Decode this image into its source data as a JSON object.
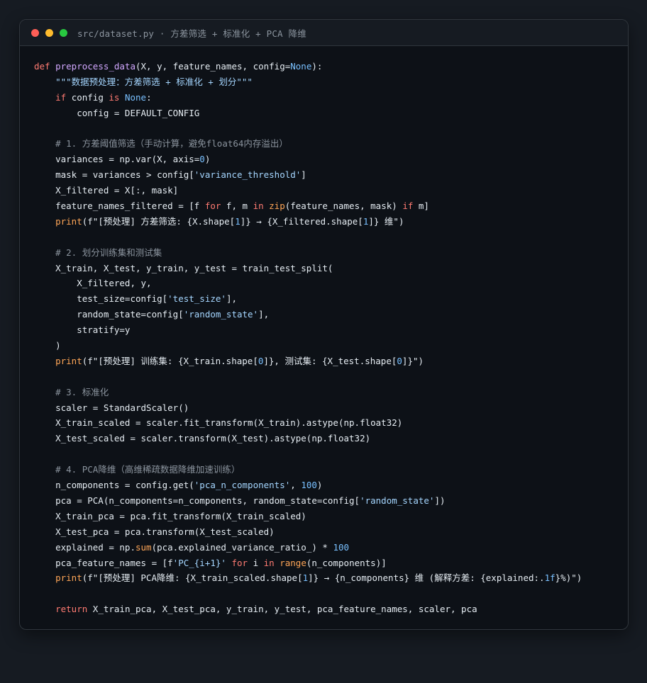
{
  "window": {
    "title": "src/dataset.py · 方差筛选 + 标准化 + PCA 降维"
  },
  "colors": {
    "background": "#161b22",
    "editor_bg": "#0d1117",
    "keyword": "#ff7b72",
    "function": "#d2a8ff",
    "builtin": "#ffa657",
    "constant": "#79c0ff",
    "string": "#a5d6ff",
    "comment": "#8b949e",
    "text": "#e6edf3"
  },
  "code_lines": [
    [
      [
        "kw",
        "def "
      ],
      [
        "fn",
        "preprocess_data"
      ],
      [
        "plain",
        "(X, y, feature_names, config="
      ],
      [
        "const",
        "None"
      ],
      [
        "plain",
        "):"
      ]
    ],
    [
      [
        "plain",
        "    "
      ],
      [
        "str",
        "\"\"\"数据预处理：方差筛选 + 标准化 + 划分\"\"\""
      ]
    ],
    [
      [
        "plain",
        "    "
      ],
      [
        "kw",
        "if"
      ],
      [
        "plain",
        " config "
      ],
      [
        "kw",
        "is"
      ],
      [
        "plain",
        " "
      ],
      [
        "const",
        "None"
      ],
      [
        "plain",
        ":"
      ]
    ],
    [
      [
        "plain",
        "        config = DEFAULT_CONFIG"
      ]
    ],
    [],
    [
      [
        "plain",
        "    "
      ],
      [
        "cmt",
        "# 1. 方差阈值筛选（手动计算，避免float64内存溢出）"
      ]
    ],
    [
      [
        "plain",
        "    variances = np.var(X, axis="
      ],
      [
        "const",
        "0"
      ],
      [
        "plain",
        ")"
      ]
    ],
    [
      [
        "plain",
        "    mask = variances > config["
      ],
      [
        "str",
        "'variance_threshold'"
      ],
      [
        "plain",
        "]"
      ]
    ],
    [
      [
        "plain",
        "    X_filtered = X[:, mask]"
      ]
    ],
    [
      [
        "plain",
        "    feature_names_filtered = [f "
      ],
      [
        "kw",
        "for"
      ],
      [
        "plain",
        " f, m "
      ],
      [
        "kw",
        "in"
      ],
      [
        "plain",
        " "
      ],
      [
        "builtin",
        "zip"
      ],
      [
        "plain",
        "(feature_names, mask) "
      ],
      [
        "kw",
        "if"
      ],
      [
        "plain",
        " m]"
      ]
    ],
    [
      [
        "plain",
        "    "
      ],
      [
        "builtin",
        "print"
      ],
      [
        "plain",
        "(f\"[预处理] 方差筛选: {X.shape["
      ],
      [
        "const",
        "1"
      ],
      [
        "plain",
        "]} → {X_filtered.shape["
      ],
      [
        "const",
        "1"
      ],
      [
        "plain",
        "]} 维\")"
      ]
    ],
    [],
    [
      [
        "plain",
        "    "
      ],
      [
        "cmt",
        "# 2. 划分训练集和测试集"
      ]
    ],
    [
      [
        "plain",
        "    X_train, X_test, y_train, y_test = train_test_split("
      ]
    ],
    [
      [
        "plain",
        "        X_filtered, y,"
      ]
    ],
    [
      [
        "plain",
        "        test_size=config["
      ],
      [
        "str",
        "'test_size'"
      ],
      [
        "plain",
        "],"
      ]
    ],
    [
      [
        "plain",
        "        random_state=config["
      ],
      [
        "str",
        "'random_state'"
      ],
      [
        "plain",
        "],"
      ]
    ],
    [
      [
        "plain",
        "        stratify=y"
      ]
    ],
    [
      [
        "plain",
        "    )"
      ]
    ],
    [
      [
        "plain",
        "    "
      ],
      [
        "builtin",
        "print"
      ],
      [
        "plain",
        "(f\"[预处理] 训练集: {X_train.shape["
      ],
      [
        "const",
        "0"
      ],
      [
        "plain",
        "]}, 测试集: {X_test.shape["
      ],
      [
        "const",
        "0"
      ],
      [
        "plain",
        "]}\")"
      ]
    ],
    [],
    [
      [
        "plain",
        "    "
      ],
      [
        "cmt",
        "# 3. 标准化"
      ]
    ],
    [
      [
        "plain",
        "    scaler = StandardScaler()"
      ]
    ],
    [
      [
        "plain",
        "    X_train_scaled = scaler.fit_transform(X_train).astype(np.float32)"
      ]
    ],
    [
      [
        "plain",
        "    X_test_scaled = scaler.transform(X_test).astype(np.float32)"
      ]
    ],
    [],
    [
      [
        "plain",
        "    "
      ],
      [
        "cmt",
        "# 4. PCA降维（高维稀疏数据降维加速训练）"
      ]
    ],
    [
      [
        "plain",
        "    n_components = config.get("
      ],
      [
        "str",
        "'pca_n_components'"
      ],
      [
        "plain",
        ", "
      ],
      [
        "const",
        "100"
      ],
      [
        "plain",
        ")"
      ]
    ],
    [
      [
        "plain",
        "    pca = PCA(n_components=n_components, random_state=config["
      ],
      [
        "str",
        "'random_state'"
      ],
      [
        "plain",
        "])"
      ]
    ],
    [
      [
        "plain",
        "    X_train_pca = pca.fit_transform(X_train_scaled)"
      ]
    ],
    [
      [
        "plain",
        "    X_test_pca = pca.transform(X_test_scaled)"
      ]
    ],
    [
      [
        "plain",
        "    explained = np."
      ],
      [
        "builtin",
        "sum"
      ],
      [
        "plain",
        "(pca.explained_variance_ratio_) * "
      ],
      [
        "const",
        "100"
      ]
    ],
    [
      [
        "plain",
        "    pca_feature_names = [f"
      ],
      [
        "str",
        "'PC_{i+1}'"
      ],
      [
        "plain",
        " "
      ],
      [
        "kw",
        "for"
      ],
      [
        "plain",
        " i "
      ],
      [
        "kw",
        "in"
      ],
      [
        "plain",
        " "
      ],
      [
        "builtin",
        "range"
      ],
      [
        "plain",
        "(n_components)]"
      ]
    ],
    [
      [
        "plain",
        "    "
      ],
      [
        "builtin",
        "print"
      ],
      [
        "plain",
        "(f\"[预处理] PCA降维: {X_train_scaled.shape["
      ],
      [
        "const",
        "1"
      ],
      [
        "plain",
        "]} → {n_components} 维 (解释方差: {explained:."
      ],
      [
        "const",
        "1f"
      ],
      [
        "plain",
        "}%)\")"
      ]
    ],
    [],
    [
      [
        "plain",
        "    "
      ],
      [
        "kw",
        "return"
      ],
      [
        "plain",
        " X_train_pca, X_test_pca, y_train, y_test, pca_feature_names, scaler, pca"
      ]
    ]
  ]
}
